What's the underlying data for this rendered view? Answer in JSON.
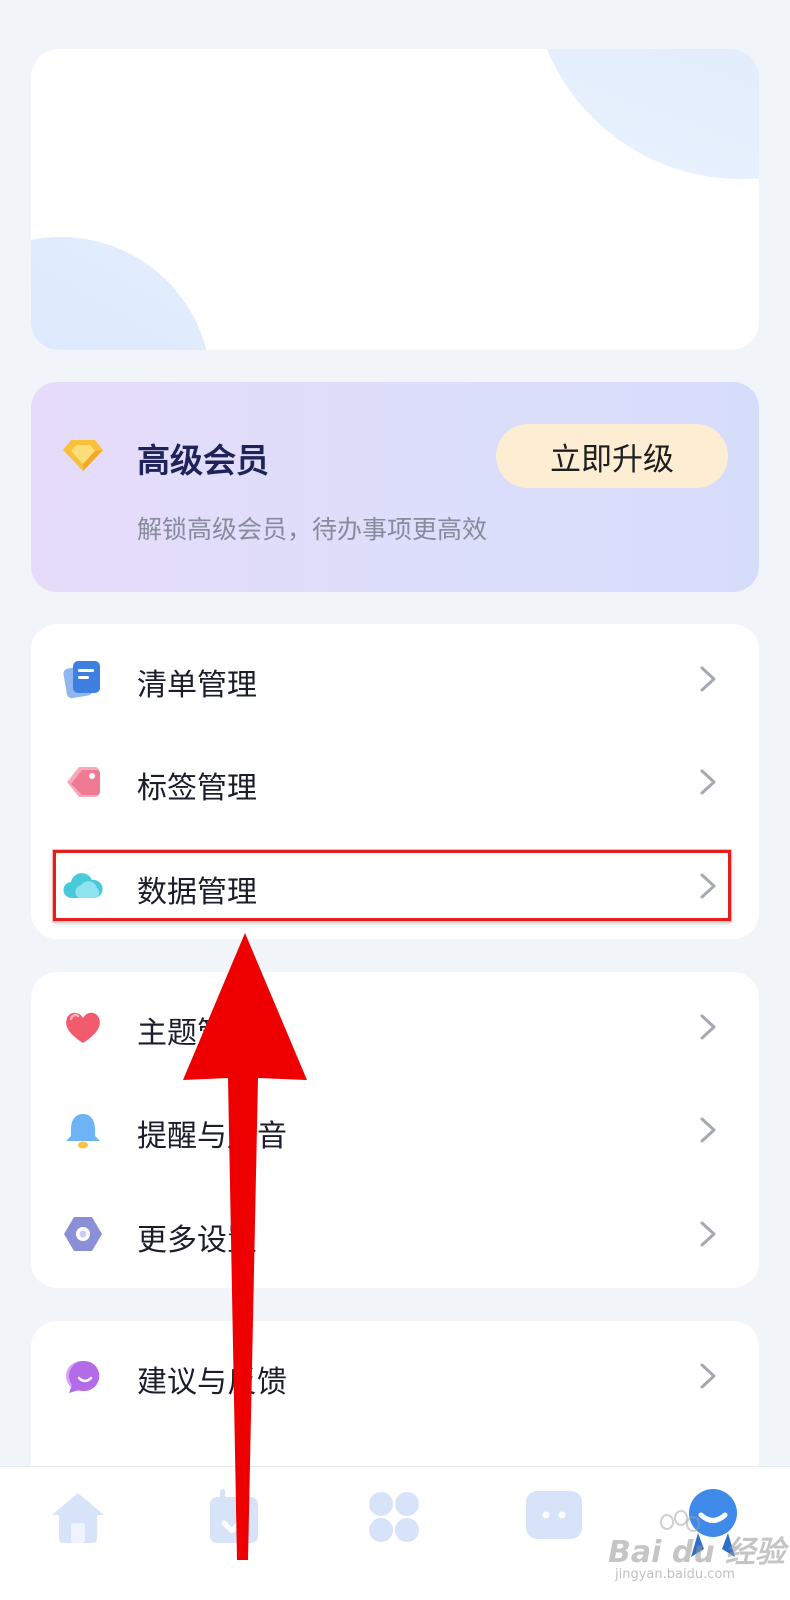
{
  "vip": {
    "title": "高级会员",
    "subtitle": "解锁高级会员，待办事项更高效",
    "upgrade_label": "立即升级",
    "icon": "diamond-icon"
  },
  "menu_groups": [
    {
      "items": [
        {
          "label": "清单管理",
          "icon": "list-icon"
        },
        {
          "label": "标签管理",
          "icon": "tag-icon"
        },
        {
          "label": "数据管理",
          "icon": "cloud-icon"
        }
      ]
    },
    {
      "items": [
        {
          "label": "主题管理",
          "icon": "heart-icon"
        },
        {
          "label": "提醒与声音",
          "icon": "bell-icon"
        },
        {
          "label": "更多设置",
          "icon": "settings-hexagon-icon"
        }
      ]
    },
    {
      "items": [
        {
          "label": "建议与反馈",
          "icon": "feedback-bubble-icon"
        }
      ]
    }
  ],
  "tabbar": {
    "tabs": [
      {
        "icon": "home-icon"
      },
      {
        "icon": "calendar-check-icon"
      },
      {
        "icon": "apps-grid-icon"
      },
      {
        "icon": "chat-bubble-icon"
      },
      {
        "icon": "profile-mascot-icon",
        "active": true
      }
    ]
  },
  "watermark": {
    "brand": "Bai du 经验",
    "url": "jingyan.baidu.com"
  },
  "colors": {
    "accent_blue": "#4a90e8",
    "annotation_red": "#e51d1d",
    "vip_button": "#fdeed3"
  }
}
